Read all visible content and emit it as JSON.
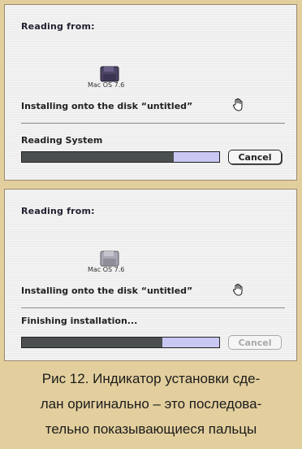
{
  "screens": [
    {
      "reading_from_label": "Reading from:",
      "disk_name": "Mac OS 7.6",
      "install_target_text": "Installing onto the disk “untitled”",
      "status_text": "Reading System",
      "progress_percent": 77,
      "cancel_label": "Cancel",
      "cancel_enabled": true
    },
    {
      "reading_from_label": "Reading from:",
      "disk_name": "Mac OS 7.6",
      "install_target_text": "Installing onto the disk “untitled”",
      "status_text": "Finishing installation...",
      "progress_percent": 71,
      "cancel_label": "Cancel",
      "cancel_enabled": false
    }
  ],
  "caption": {
    "line1": "Рис 12. Индикатор установки сде-",
    "line2": "лан оригинально – это последова-",
    "line3": "тельно показывающиеся пальцы"
  },
  "icons": [
    "disk-icon",
    "hand-icon"
  ],
  "colors": {
    "progress_fill": "#4c4f50",
    "progress_track": "#c8c8f2",
    "caption_background": "#e3cf9e"
  }
}
